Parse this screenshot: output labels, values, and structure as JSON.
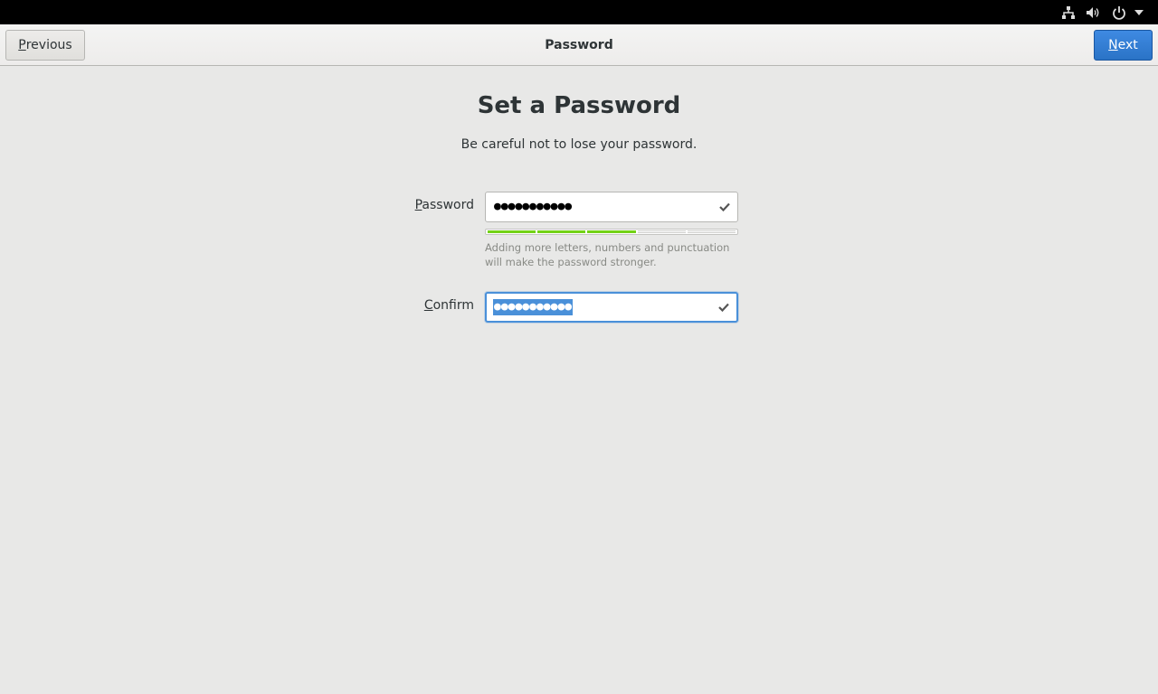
{
  "header": {
    "previous_label": "Previous",
    "previous_mnemonic": "P",
    "previous_rest": "revious",
    "title": "Password",
    "next_label": "Next",
    "next_mnemonic": "N",
    "next_rest": "ext"
  },
  "tray": {
    "icons": [
      "network-wired-icon",
      "volume-icon",
      "power-icon",
      "chevron-down-icon"
    ]
  },
  "main": {
    "heading": "Set a Password",
    "subtitle": "Be careful not to lose your password.",
    "password": {
      "label_mnemonic": "P",
      "label_rest": "assword",
      "masked_value": "●●●●●●●●●●●",
      "valid": true
    },
    "strength": {
      "segments_total": 5,
      "segments_filled": 3,
      "color": "#73d216"
    },
    "hint": "Adding more letters, numbers and punctuation will make the password stronger.",
    "confirm": {
      "label_mnemonic": "C",
      "label_rest": "onfirm",
      "masked_value": "●●●●●●●●●●●",
      "selected": true,
      "valid": true
    }
  },
  "colors": {
    "accent": "#4a90d9",
    "next_button": "#2a73c6",
    "strength_fill": "#73d216"
  }
}
